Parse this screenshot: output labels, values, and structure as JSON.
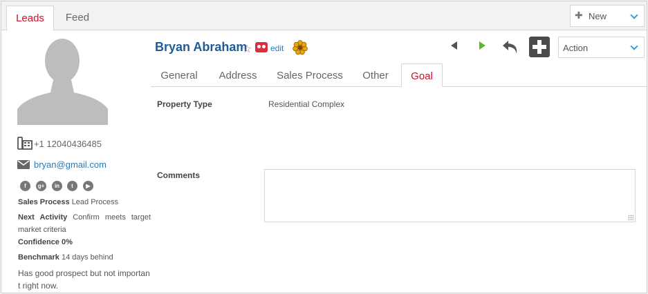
{
  "top_tabs": [
    {
      "label": "Leads",
      "active": true
    },
    {
      "label": "Feed",
      "active": false
    }
  ],
  "new_select": {
    "label": "New",
    "icon": "plus-icon"
  },
  "lead": {
    "name": "Bryan Abraham",
    "edit_label": "edit",
    "phone": "+1 12040436485",
    "email": "bryan@gmail.com"
  },
  "social_icons": [
    "facebook-icon",
    "google-plus-icon",
    "linkedin-icon",
    "twitter-icon",
    "youtube-icon"
  ],
  "info": {
    "sales_process_label": "Sales Process",
    "sales_process_value": "Lead Process",
    "next_activity_label": "Next Activity",
    "next_activity_value": "Confirm meets target market criteria",
    "confidence_label": "Confidence",
    "confidence_value": "0%",
    "benchmark_label": "Benchmark",
    "benchmark_value": "14 days behind",
    "notes": "Has good prospect but not important right now."
  },
  "action_select": {
    "label": "Action"
  },
  "sub_tabs": [
    {
      "label": "General",
      "active": false
    },
    {
      "label": "Address",
      "active": false
    },
    {
      "label": "Sales Process",
      "active": false
    },
    {
      "label": "Other",
      "active": false
    },
    {
      "label": "Goal",
      "active": true
    }
  ],
  "goal": {
    "property_type_label": "Property Type",
    "property_type_value": "Residential Complex",
    "comments_label": "Comments",
    "comments_value": ""
  },
  "colors": {
    "accent_red": "#c8102e",
    "link_blue": "#2a7ab8",
    "name_blue": "#1f5c96",
    "next_green": "#5cb82b"
  }
}
